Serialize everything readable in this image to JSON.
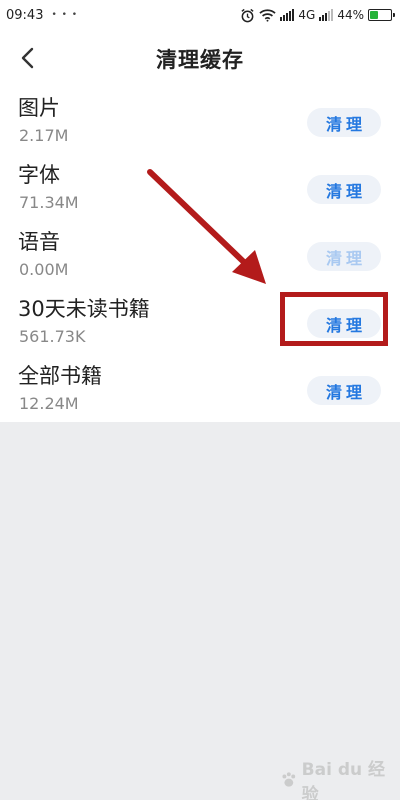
{
  "status_bar": {
    "time": "09:43",
    "dots": "• • •",
    "network": "4G",
    "battery_percent": "44%",
    "battery_level": 0.44
  },
  "header": {
    "title": "清理缓存"
  },
  "cache_items": [
    {
      "name": "图片",
      "size": "2.17M",
      "button_label": "清理",
      "enabled": true
    },
    {
      "name": "字体",
      "size": "71.34M",
      "button_label": "清理",
      "enabled": true
    },
    {
      "name": "语音",
      "size": "0.00M",
      "button_label": "清理",
      "enabled": false
    },
    {
      "name": "30天未读书籍",
      "size": "561.73K",
      "button_label": "清理",
      "enabled": true
    },
    {
      "name": "全部书籍",
      "size": "12.24M",
      "button_label": "清理",
      "enabled": true
    }
  ],
  "colors": {
    "accent": "#2478e0",
    "accent_disabled": "#a9c9f1",
    "annotation": "#b31b1b",
    "background": "#ecedef"
  },
  "watermark": {
    "text": "Bai du 经验"
  }
}
